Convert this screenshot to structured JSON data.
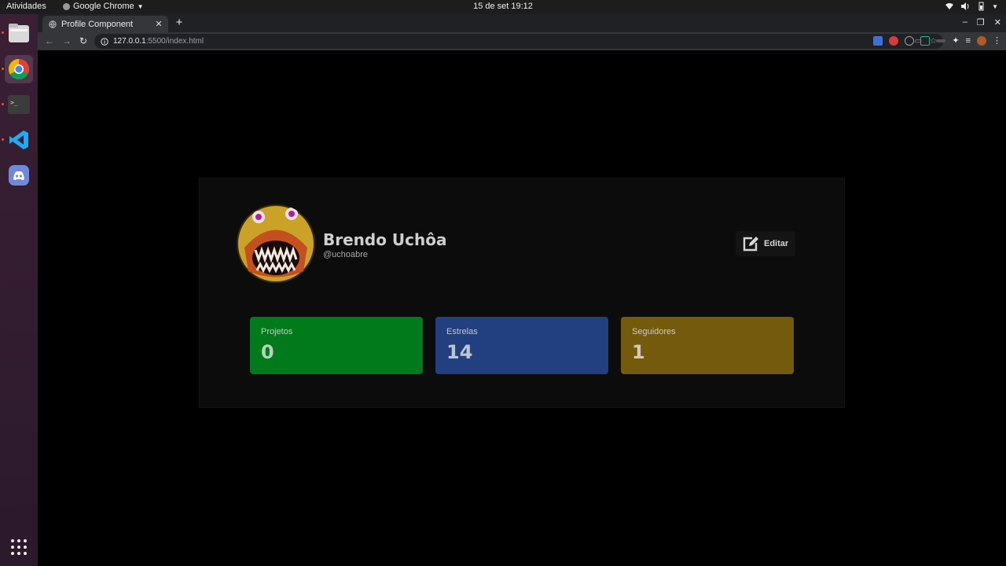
{
  "topbar": {
    "activities": "Atividades",
    "app_name": "Google Chrome",
    "clock": "15 de set  19:12"
  },
  "dock": {
    "items": [
      {
        "name": "files-icon"
      },
      {
        "name": "chrome-icon"
      },
      {
        "name": "terminal-icon"
      },
      {
        "name": "vscode-icon"
      },
      {
        "name": "discord-icon"
      },
      {
        "name": "app-grid-icon"
      }
    ]
  },
  "browser": {
    "tab_title": "Profile Component",
    "url_host": "127.0.0.1",
    "url_path": ":5500/index.html"
  },
  "profile": {
    "name": "Brendo Uchôa",
    "handle": "@uchoabre",
    "edit_label": "Editar",
    "stats": [
      {
        "label": "Projetos",
        "value": "0",
        "color": "#017a1b"
      },
      {
        "label": "Estrelas",
        "value": "14",
        "color": "#22407f"
      },
      {
        "label": "Seguidores",
        "value": "1",
        "color": "#735a0d"
      }
    ]
  }
}
